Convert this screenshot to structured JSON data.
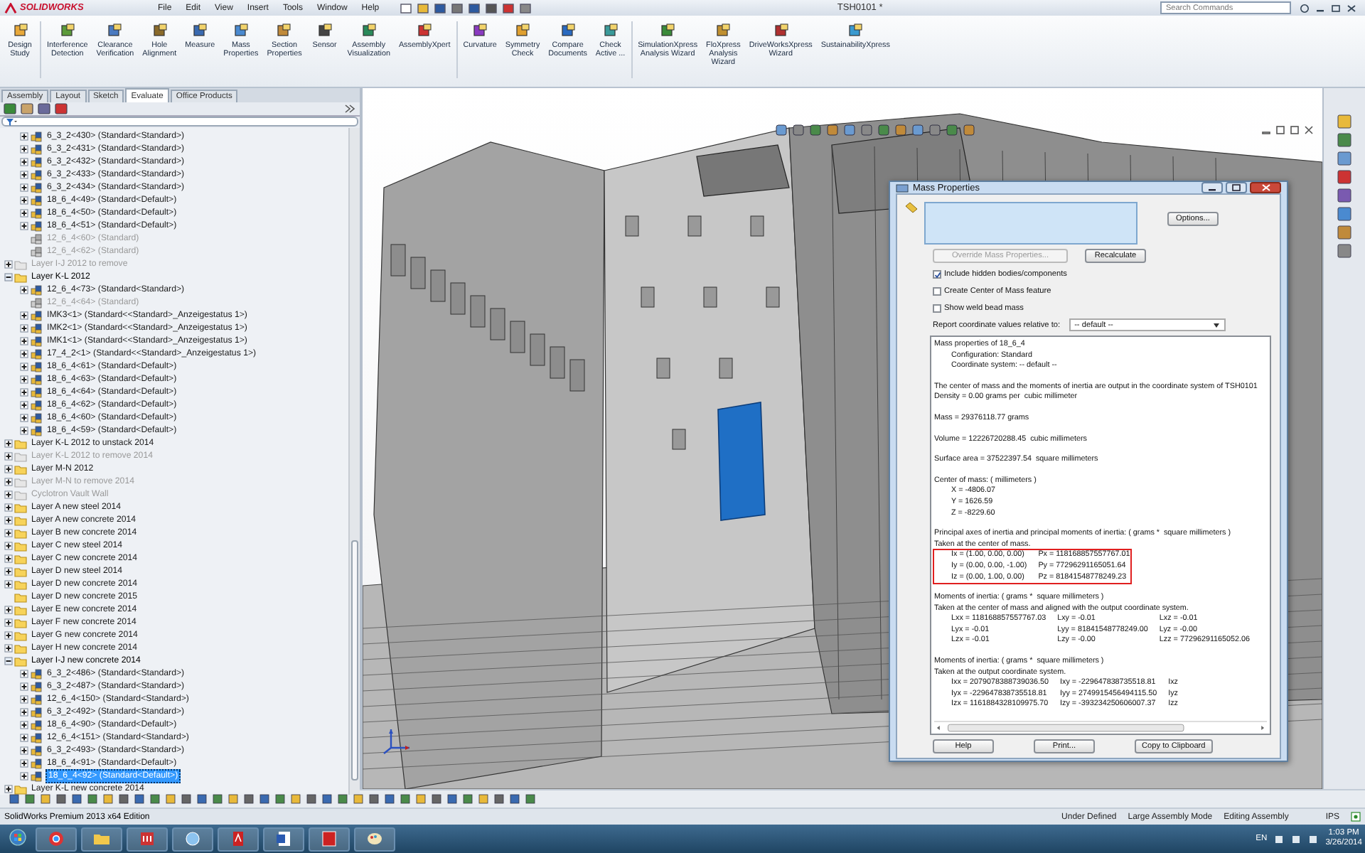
{
  "app": {
    "logo": "SOLIDWORKS",
    "menu": [
      "File",
      "Edit",
      "View",
      "Insert",
      "Tools",
      "Window",
      "Help"
    ],
    "document_title": "TSH0101 *",
    "search": {
      "placeholder": "Search Commands"
    }
  },
  "ribbon": [
    {
      "label": "Design\nStudy"
    },
    {
      "label": "Interference\nDetection"
    },
    {
      "label": "Clearance\nVerification"
    },
    {
      "label": "Hole\nAlignment"
    },
    {
      "label": "Measure"
    },
    {
      "label": "Mass\nProperties"
    },
    {
      "label": "Section\nProperties"
    },
    {
      "label": "Sensor"
    },
    {
      "label": "Assembly\nVisualization"
    },
    {
      "label": "AssemblyXpert"
    },
    {
      "label": "Curvature"
    },
    {
      "label": "Symmetry\nCheck"
    },
    {
      "label": "Compare\nDocuments"
    },
    {
      "label": "Check\nActive ..."
    },
    {
      "label": "SimulationXpress\nAnalysis Wizard"
    },
    {
      "label": "FloXpress\nAnalysis\nWizard"
    },
    {
      "label": "DriveWorksXpress\nWizard"
    },
    {
      "label": "SustainabilityXpress"
    }
  ],
  "command_tabs": [
    {
      "label": "Assembly",
      "selected": false
    },
    {
      "label": "Layout",
      "selected": false
    },
    {
      "label": "Sketch",
      "selected": false
    },
    {
      "label": "Evaluate",
      "selected": true
    },
    {
      "label": "Office Products",
      "selected": false
    }
  ],
  "tree": {
    "continued_children": [
      {
        "label": "6_3_2<430> (Standard<Standard>)",
        "kind": "part",
        "expandable": true,
        "expanded": false,
        "suppressed": false,
        "selected": false
      },
      {
        "label": "6_3_2<431> (Standard<Standard>)",
        "kind": "part",
        "expandable": true,
        "expanded": false,
        "suppressed": false,
        "selected": false
      },
      {
        "label": "6_3_2<432> (Standard<Standard>)",
        "kind": "part",
        "expandable": true,
        "expanded": false,
        "suppressed": false,
        "selected": false
      },
      {
        "label": "6_3_2<433> (Standard<Standard>)",
        "kind": "part",
        "expandable": true,
        "expanded": false,
        "suppressed": false,
        "selected": false
      },
      {
        "label": "6_3_2<434> (Standard<Standard>)",
        "kind": "part",
        "expandable": true,
        "expanded": false,
        "suppressed": false,
        "selected": false
      },
      {
        "label": "18_6_4<49> (Standard<Default>)",
        "kind": "part",
        "expandable": true,
        "expanded": false,
        "suppressed": false,
        "selected": false
      },
      {
        "label": "18_6_4<50> (Standard<Default>)",
        "kind": "part",
        "expandable": true,
        "expanded": false,
        "suppressed": false,
        "selected": false
      },
      {
        "label": "18_6_4<51> (Standard<Default>)",
        "kind": "part",
        "expandable": true,
        "expanded": false,
        "suppressed": false,
        "selected": false
      },
      {
        "label": "12_6_4<60> (Standard)",
        "kind": "part",
        "expandable": false,
        "expanded": false,
        "suppressed": true,
        "selected": false
      },
      {
        "label": "12_6_4<62> (Standard)",
        "kind": "part",
        "expandable": false,
        "expanded": false,
        "suppressed": true,
        "selected": false
      }
    ],
    "items": [
      {
        "label": "Layer I-J 2012 to remove",
        "kind": "folder",
        "expandable": true,
        "expanded": false,
        "suppressed": true,
        "selected": false
      },
      {
        "label": "Layer K-L 2012",
        "kind": "folder",
        "expandable": true,
        "expanded": true,
        "suppressed": false,
        "selected": false,
        "children": [
          {
            "label": "12_6_4<73> (Standard<Standard>)",
            "kind": "part",
            "expandable": true,
            "expanded": false,
            "suppressed": false,
            "selected": false
          },
          {
            "label": "12_6_4<64> (Standard)",
            "kind": "part",
            "expandable": false,
            "expanded": false,
            "suppressed": true,
            "selected": false
          },
          {
            "label": "IMK3<1> (Standard<<Standard>_Anzeigestatus 1>)",
            "kind": "part",
            "expandable": true,
            "expanded": false,
            "suppressed": false,
            "selected": false
          },
          {
            "label": "IMK2<1> (Standard<<Standard>_Anzeigestatus 1>)",
            "kind": "part",
            "expandable": true,
            "expanded": false,
            "suppressed": false,
            "selected": false
          },
          {
            "label": "IMK1<1> (Standard<<Standard>_Anzeigestatus 1>)",
            "kind": "part",
            "expandable": true,
            "expanded": false,
            "suppressed": false,
            "selected": false
          },
          {
            "label": "17_4_2<1> (Standard<<Standard>_Anzeigestatus 1>)",
            "kind": "part",
            "expandable": true,
            "expanded": false,
            "suppressed": false,
            "selected": false
          },
          {
            "label": "18_6_4<61> (Standard<Default>)",
            "kind": "part",
            "expandable": true,
            "expanded": false,
            "suppressed": false,
            "selected": false
          },
          {
            "label": "18_6_4<63> (Standard<Default>)",
            "kind": "part",
            "expandable": true,
            "expanded": false,
            "suppressed": false,
            "selected": false
          },
          {
            "label": "18_6_4<64> (Standard<Default>)",
            "kind": "part",
            "expandable": true,
            "expanded": false,
            "suppressed": false,
            "selected": false
          },
          {
            "label": "18_6_4<62> (Standard<Default>)",
            "kind": "part",
            "expandable": true,
            "expanded": false,
            "suppressed": false,
            "selected": false
          },
          {
            "label": "18_6_4<60> (Standard<Default>)",
            "kind": "part",
            "expandable": true,
            "expanded": false,
            "suppressed": false,
            "selected": false
          },
          {
            "label": "18_6_4<59> (Standard<Default>)",
            "kind": "part",
            "expandable": true,
            "expanded": false,
            "suppressed": false,
            "selected": false
          }
        ]
      },
      {
        "label": "Layer K-L 2012 to unstack 2014",
        "kind": "folder",
        "expandable": true,
        "expanded": false,
        "suppressed": false,
        "selected": false
      },
      {
        "label": "Layer K-L 2012 to remove 2014",
        "kind": "folder",
        "expandable": true,
        "expanded": false,
        "suppressed": true,
        "selected": false
      },
      {
        "label": "Layer M-N 2012",
        "kind": "folder",
        "expandable": true,
        "expanded": false,
        "suppressed": false,
        "selected": false
      },
      {
        "label": "Layer M-N to remove 2014",
        "kind": "folder",
        "expandable": true,
        "expanded": false,
        "suppressed": true,
        "selected": false
      },
      {
        "label": "Cyclotron Vault Wall",
        "kind": "folder",
        "expandable": true,
        "expanded": false,
        "suppressed": true,
        "selected": false
      },
      {
        "label": "Layer A new steel 2014",
        "kind": "folder",
        "expandable": true,
        "expanded": false,
        "suppressed": false,
        "selected": false
      },
      {
        "label": "Layer A new concrete 2014",
        "kind": "folder",
        "expandable": true,
        "expanded": false,
        "suppressed": false,
        "selected": false
      },
      {
        "label": "Layer B new concrete 2014",
        "kind": "folder",
        "expandable": true,
        "expanded": false,
        "suppressed": false,
        "selected": false
      },
      {
        "label": "Layer C new steel 2014",
        "kind": "folder",
        "expandable": true,
        "expanded": false,
        "suppressed": false,
        "selected": false
      },
      {
        "label": "Layer C new concrete 2014",
        "kind": "folder",
        "expandable": true,
        "expanded": false,
        "suppressed": false,
        "selected": false
      },
      {
        "label": "Layer D new steel 2014",
        "kind": "folder",
        "expandable": true,
        "expanded": false,
        "suppressed": false,
        "selected": false
      },
      {
        "label": "Layer D new concrete 2014",
        "kind": "folder",
        "expandable": true,
        "expanded": false,
        "suppressed": false,
        "selected": false
      },
      {
        "label": "Layer D new concrete 2015",
        "kind": "folder",
        "expandable": false,
        "expanded": false,
        "suppressed": false,
        "selected": false
      },
      {
        "label": "Layer E new concrete 2014",
        "kind": "folder",
        "expandable": true,
        "expanded": false,
        "suppressed": false,
        "selected": false
      },
      {
        "label": "Layer F new concrete 2014",
        "kind": "folder",
        "expandable": true,
        "expanded": false,
        "suppressed": false,
        "selected": false
      },
      {
        "label": "Layer G new concrete 2014",
        "kind": "folder",
        "expandable": true,
        "expanded": false,
        "suppressed": false,
        "selected": false
      },
      {
        "label": "Layer H new concrete 2014",
        "kind": "folder",
        "expandable": true,
        "expanded": false,
        "suppressed": false,
        "selected": false
      },
      {
        "label": "Layer I-J new concrete 2014",
        "kind": "folder",
        "expandable": true,
        "expanded": true,
        "suppressed": false,
        "selected": false,
        "children": [
          {
            "label": "6_3_2<486> (Standard<Standard>)",
            "kind": "part",
            "expandable": true,
            "expanded": false,
            "suppressed": false,
            "selected": false
          },
          {
            "label": "6_3_2<487> (Standard<Standard>)",
            "kind": "part",
            "expandable": true,
            "expanded": false,
            "suppressed": false,
            "selected": false
          },
          {
            "label": "12_6_4<150> (Standard<Standard>)",
            "kind": "part",
            "expandable": true,
            "expanded": false,
            "suppressed": false,
            "selected": false
          },
          {
            "label": "6_3_2<492> (Standard<Standard>)",
            "kind": "part",
            "expandable": true,
            "expanded": false,
            "suppressed": false,
            "selected": false
          },
          {
            "label": "18_6_4<90> (Standard<Default>)",
            "kind": "part",
            "expandable": true,
            "expanded": false,
            "suppressed": false,
            "selected": false
          },
          {
            "label": "12_6_4<151> (Standard<Standard>)",
            "kind": "part",
            "expandable": true,
            "expanded": false,
            "suppressed": false,
            "selected": false
          },
          {
            "label": "6_3_2<493> (Standard<Standard>)",
            "kind": "part",
            "expandable": true,
            "expanded": false,
            "suppressed": false,
            "selected": false
          },
          {
            "label": "18_6_4<91> (Standard<Default>)",
            "kind": "part",
            "expandable": true,
            "expanded": false,
            "suppressed": false,
            "selected": false
          },
          {
            "label": "18_6_4<92> (Standard<Default>)",
            "kind": "part",
            "expandable": true,
            "expanded": false,
            "suppressed": false,
            "selected": true
          }
        ]
      },
      {
        "label": "Layer K-L new concrete 2014",
        "kind": "folder",
        "expandable": true,
        "expanded": false,
        "suppressed": false,
        "selected": false
      }
    ]
  },
  "dialog": {
    "title": "Mass Properties",
    "options_button": "Options...",
    "override_button": {
      "label": "Override Mass Properties...",
      "disabled": true
    },
    "recalculate_button": "Recalculate",
    "checkboxes": [
      {
        "label": "Include hidden bodies/components",
        "checked": true
      },
      {
        "label": "Create Center of Mass feature",
        "checked": false
      },
      {
        "label": "Show weld bead mass",
        "checked": false
      }
    ],
    "coordinate_label": "Report coordinate values relative to:",
    "coordinate_value": "-- default --",
    "output": [
      {
        "lines": [
          {
            "text": "Mass properties of 18_6_4",
            "indented": false
          },
          {
            "text": "Configuration: Standard",
            "indented": true
          },
          {
            "text": "Coordinate system: -- default --",
            "indented": true
          }
        ]
      },
      {
        "lines": [
          {
            "text": "The center of mass and the moments of inertia are output in the coordinate system of TSH0101",
            "indented": false
          },
          {
            "text": "Density = 0.00 grams per  cubic millimeter",
            "indented": false
          }
        ]
      },
      {
        "lines": [
          {
            "text": "Mass = 29376118.77 grams",
            "indented": false
          }
        ]
      },
      {
        "lines": [
          {
            "text": "Volume = 12226720288.45  cubic millimeters",
            "indented": false
          }
        ]
      },
      {
        "lines": [
          {
            "text": "Surface area = 37522397.54  square millimeters",
            "indented": false
          }
        ]
      },
      {
        "lines": [
          {
            "text": "Center of mass: ( millimeters )",
            "indented": false
          },
          {
            "text": "X = -4806.07",
            "indented": true
          },
          {
            "text": "Y = 1626.59",
            "indented": true
          },
          {
            "text": "Z = -8229.60",
            "indented": true
          }
        ]
      },
      {
        "lines": [
          {
            "text": "Principal axes of inertia and principal moments of inertia: ( grams *  square millimeters )",
            "indented": false
          },
          {
            "text": "Taken at the center of mass.",
            "indented": false
          }
        ],
        "table": {
          "highlighted": true,
          "rows": [
            [
              "Ix = (1.00, 0.00, 0.00)",
              "Px = 118168857557767.01"
            ],
            [
              "Iy = (0.00, 0.00, -1.00)",
              "Py = 77296291165051.64"
            ],
            [
              "Iz = (0.00, 1.00, 0.00)",
              "Pz = 81841548778249.23"
            ]
          ]
        }
      },
      {
        "lines": [
          {
            "text": "Moments of inertia: ( grams *  square millimeters )",
            "indented": false
          },
          {
            "text": "Taken at the center of mass and aligned with the output coordinate system.",
            "indented": false
          }
        ],
        "table": {
          "highlighted": false,
          "rows": [
            [
              "Lxx = 118168857557767.03",
              "Lxy = -0.01",
              "Lxz = -0.01"
            ],
            [
              "Lyx = -0.01",
              "Lyy = 81841548778249.00",
              "Lyz = -0.00"
            ],
            [
              "Lzx = -0.01",
              "Lzy = -0.00",
              "Lzz = 77296291165052.06"
            ]
          ]
        }
      },
      {
        "lines": [
          {
            "text": "Moments of inertia: ( grams *  square millimeters )",
            "indented": false
          },
          {
            "text": "Taken at the output coordinate system.",
            "indented": false
          }
        ],
        "table": {
          "highlighted": false,
          "rows": [
            [
              "Ixx = 2079078388739036.50",
              "Ixy = -229647838735518.81",
              "Ixz"
            ],
            [
              "Iyx = -229647838735518.81",
              "Iyy = 2749915456494115.50",
              "Iyz"
            ],
            [
              "Izx = 1161884328109975.70",
              "Izy = -393234250606007.37",
              "Izz"
            ]
          ]
        }
      }
    ],
    "buttons": [
      "Help",
      "Print...",
      "Copy to Clipboard"
    ]
  },
  "status_bar": {
    "edition": "SolidWorks Premium 2013 x64 Edition",
    "items": [
      "Under Defined",
      "Large Assembly Mode",
      "Editing Assembly"
    ],
    "units": "IPS"
  },
  "taskbar": {
    "language": "EN",
    "time": "1:03 PM",
    "date": "3/26/2014"
  }
}
